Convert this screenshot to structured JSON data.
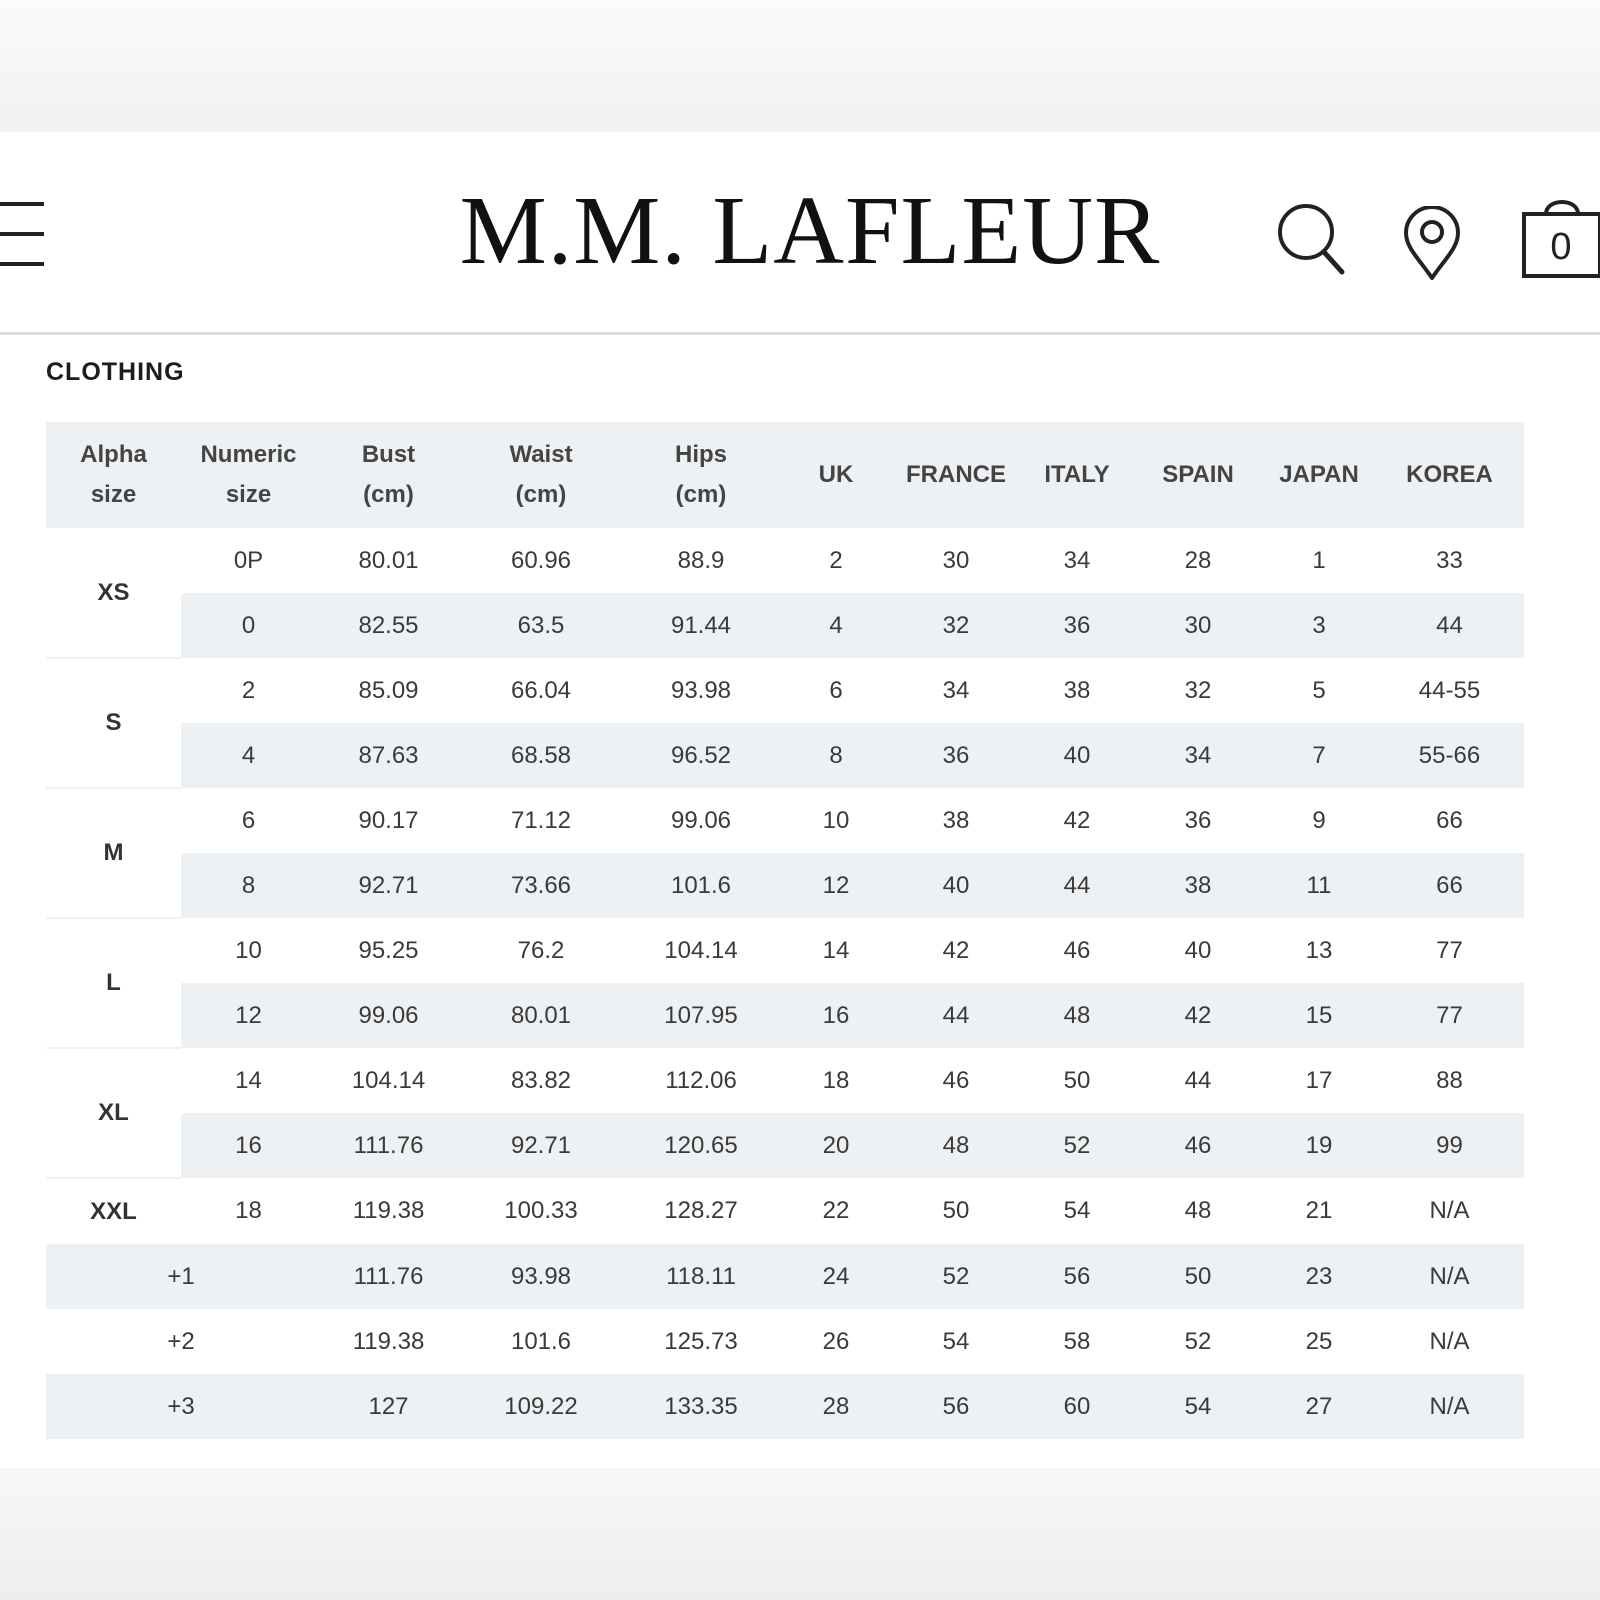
{
  "brand": {
    "name": "M.M. LAFLEUR"
  },
  "header": {
    "cart_count": "0"
  },
  "section": {
    "title": "CLOTHING"
  },
  "table": {
    "headers": [
      [
        "Alpha",
        "size"
      ],
      [
        "Numeric",
        "size"
      ],
      [
        "Bust",
        "(cm)"
      ],
      [
        "Waist",
        "(cm)"
      ],
      [
        "Hips",
        "(cm)"
      ],
      [
        "UK"
      ],
      [
        "FRANCE"
      ],
      [
        "ITALY"
      ],
      [
        "SPAIN"
      ],
      [
        "JAPAN"
      ],
      [
        "KOREA"
      ]
    ],
    "groups": [
      {
        "alpha": "XS",
        "rows": [
          [
            "0P",
            "80.01",
            "60.96",
            "88.9",
            "2",
            "30",
            "34",
            "28",
            "1",
            "33"
          ],
          [
            "0",
            "82.55",
            "63.5",
            "91.44",
            "4",
            "32",
            "36",
            "30",
            "3",
            "44"
          ]
        ]
      },
      {
        "alpha": "S",
        "rows": [
          [
            "2",
            "85.09",
            "66.04",
            "93.98",
            "6",
            "34",
            "38",
            "32",
            "5",
            "44-55"
          ],
          [
            "4",
            "87.63",
            "68.58",
            "96.52",
            "8",
            "36",
            "40",
            "34",
            "7",
            "55-66"
          ]
        ]
      },
      {
        "alpha": "M",
        "rows": [
          [
            "6",
            "90.17",
            "71.12",
            "99.06",
            "10",
            "38",
            "42",
            "36",
            "9",
            "66"
          ],
          [
            "8",
            "92.71",
            "73.66",
            "101.6",
            "12",
            "40",
            "44",
            "38",
            "11",
            "66"
          ]
        ]
      },
      {
        "alpha": "L",
        "rows": [
          [
            "10",
            "95.25",
            "76.2",
            "104.14",
            "14",
            "42",
            "46",
            "40",
            "13",
            "77"
          ],
          [
            "12",
            "99.06",
            "80.01",
            "107.95",
            "16",
            "44",
            "48",
            "42",
            "15",
            "77"
          ]
        ]
      },
      {
        "alpha": "XL",
        "rows": [
          [
            "14",
            "104.14",
            "83.82",
            "112.06",
            "18",
            "46",
            "50",
            "44",
            "17",
            "88"
          ],
          [
            "16",
            "111.76",
            "92.71",
            "120.65",
            "20",
            "48",
            "52",
            "46",
            "19",
            "99"
          ]
        ]
      },
      {
        "alpha": "XXL",
        "rows": [
          [
            "18",
            "119.38",
            "100.33",
            "128.27",
            "22",
            "50",
            "54",
            "48",
            "21",
            "N/A"
          ]
        ]
      }
    ],
    "plus_rows": [
      [
        "+1",
        "111.76",
        "93.98",
        "118.11",
        "24",
        "52",
        "56",
        "50",
        "23",
        "N/A"
      ],
      [
        "+2",
        "119.38",
        "101.6",
        "125.73",
        "26",
        "54",
        "58",
        "52",
        "25",
        "N/A"
      ],
      [
        "+3",
        "127",
        "109.22",
        "133.35",
        "28",
        "56",
        "60",
        "54",
        "27",
        "N/A"
      ]
    ]
  }
}
